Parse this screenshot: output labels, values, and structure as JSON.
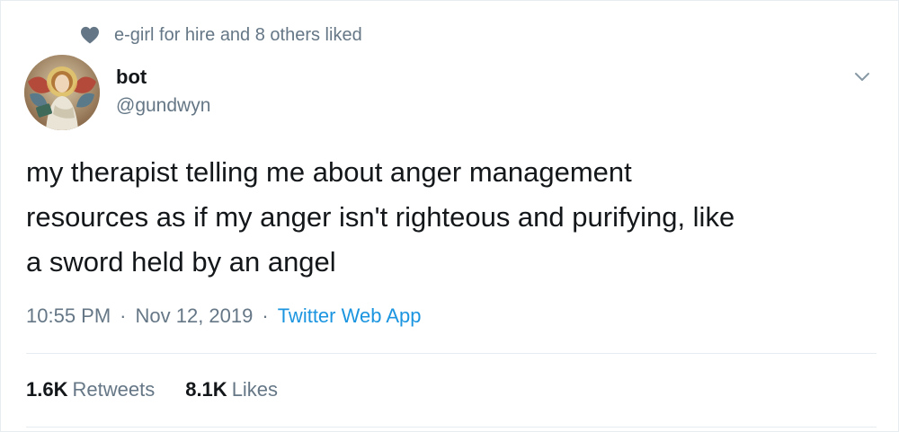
{
  "social_context": {
    "icon": "heart-icon",
    "text": "e-girl for hire and 8 others liked"
  },
  "author": {
    "avatar_icon": "angel-painting-avatar",
    "display_name": "bot",
    "handle": "@gundwyn"
  },
  "tweet": {
    "text": "my therapist telling me about anger management\nresources as if my anger isn't righteous and purifying, like\na sword held by an angel"
  },
  "meta": {
    "time": "10:55 PM",
    "separator": "·",
    "date": "Nov 12, 2019",
    "source": "Twitter Web App"
  },
  "stats": {
    "retweets_count": "1.6K",
    "retweets_label": "Retweets",
    "likes_count": "8.1K",
    "likes_label": "Likes"
  },
  "colors": {
    "text": "#14171a",
    "muted": "#657786",
    "link": "#1b95e0",
    "border": "#e6ecf0"
  }
}
